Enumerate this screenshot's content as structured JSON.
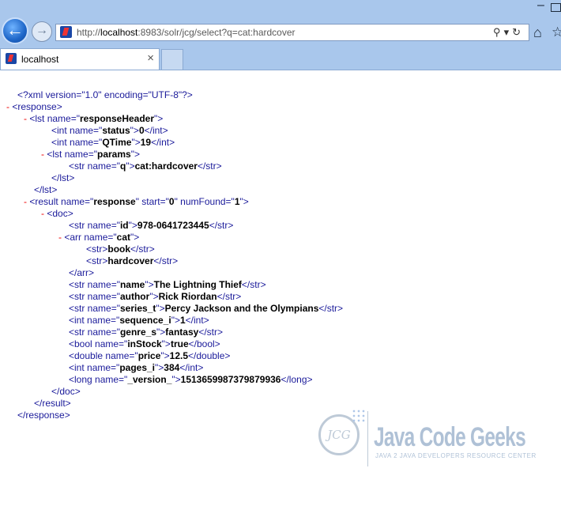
{
  "browser": {
    "url_prefix": "http://",
    "url_host": "localhost",
    "url_rest": ":8983/solr/jcg/select?q=cat:hardcover",
    "tab_title": "localhost",
    "tab_close": "×",
    "window_min": "–"
  },
  "xml": {
    "decl": "<?xml version=\"1.0\" encoding=\"UTF-8\"?>",
    "response_header": {
      "name": "responseHeader",
      "status": "0",
      "qtime": "19",
      "params_name": "params",
      "q": "cat:hardcover"
    },
    "result": {
      "name": "response",
      "start": "0",
      "numFound": "1"
    },
    "doc": {
      "id": "978-0641723445",
      "cat": [
        "book",
        "hardcover"
      ],
      "name": "The Lightning Thief",
      "author": "Rick Riordan",
      "series_t": "Percy Jackson and the Olympians",
      "sequence_i": "1",
      "genre_s": "fantasy",
      "inStock": "true",
      "price": "12.5",
      "pages_i": "384",
      "version": "1513659987379879936"
    }
  },
  "watermark": {
    "logo_letters": "JCG",
    "title": "Java Code Geeks",
    "subtitle": "JAVA 2 JAVA DEVELOPERS RESOURCE CENTER"
  }
}
